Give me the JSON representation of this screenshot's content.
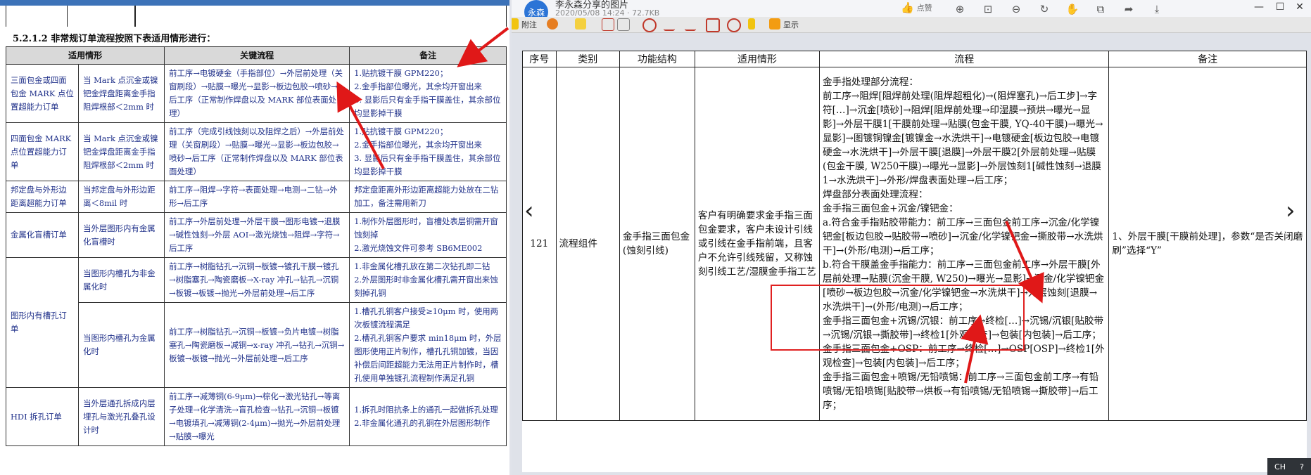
{
  "left_doc": {
    "section_title": "5.2.1.2 非常规订单流程按照下表适用情形进行：",
    "headers": [
      "适用情形",
      "关键流程",
      "备注"
    ],
    "rows": [
      {
        "case": "三面包金或四面包金 MARK 点位置超能力订单",
        "cond": "当 Mark 点沉金或镍钯金焊盘距离金手指阻焊根部＜2mm 时",
        "flow": "前工序→电镀硬金（手指部位）→外层前处理（关窗刷段）→贴膜→曝光→显影→板边包胶→喷砂→后工序（正常制作焊盘以及 MARK 部位表面处理）",
        "note": "1.贴抗镀干膜 GPM220；\n2.金手指部位曝光，其余均开窗出来\n3. 显影后只有金手指干膜盖住，其余部位均显影掉干膜"
      },
      {
        "case": "四面包金 MARK 点位置超能力订单",
        "cond": "当 Mark 点沉金或镍钯金焊盘距离金手指阻焊根部＜2mm 时",
        "flow": "前工序（完成引线蚀刻以及阻焊之后）→外层前处理（关窗刷段）→贴膜→曝光→显影→板边包胶→喷砂→后工序（正常制作焊盘以及 MARK 部位表面处理）",
        "note": "1.贴抗镀干膜 GPM220；\n2.金手指部位曝光，其余均开窗出来\n3. 显影后只有金手指干膜盖住，其余部位均显影掉干膜"
      },
      {
        "case": "邦定盘与外形边距离超能力订单",
        "cond": "当邦定盘与外形边距离＜8mil 时",
        "flow": "前工序→阻焊→字符→表面处理→电测→二钻→外形→后工序",
        "note": "邦定盘距离外形边距离超能力处放在二钻加工，备注需用新刀"
      },
      {
        "case": "金属化盲槽订单",
        "cond": "当外层图形内有金属化盲槽时",
        "flow": "前工序→外层前处理→外层干膜→图形电镀→退膜→碱性蚀刻→外层 AOI→激光烧蚀→阻焊→字符→后工序",
        "note": "1.制作外层图形时，盲槽处表层铜需开窗蚀刻掉\n2.激光烧蚀文件可参考 SB6ME002"
      },
      {
        "case": "图形内有槽孔订单",
        "cond": "当图形内槽孔为非金属化时",
        "flow": "前工序→树脂钻孔→沉铜→板镀→镀孔干膜→镀孔→树脂塞孔→陶瓷磨板→X-ray 冲孔→钻孔→沉铜→板镀→板镀→抛光→外层前处理→后工序",
        "note": "1.非金属化槽孔放在第二次钻孔即二钻\n2.外层图形时非金属化槽孔需开窗出来蚀刻掉孔铜"
      },
      {
        "case": "",
        "cond": "当图形内槽孔为金属化时",
        "flow": "前工序→树脂钻孔→沉铜→板镀→负片电镀→树脂塞孔→陶瓷磨板→减铜→x-ray 冲孔→钻孔→沉铜→板镀→板镀→抛光→外层前处理→后工序",
        "note": "1.槽孔孔铜客户接受≥10μm 时，使用两次板镀流程满足\n2.槽孔孔铜客户要求 min18μm 时，外层图形使用正片制作，槽孔孔铜加镀，当因补偿后间距超能力无法用正片制作时，槽孔使用单独镀孔流程制作满足孔铜"
      },
      {
        "case": "HDI 拆孔订单",
        "cond": "当外层通孔拆成内层埋孔与激光孔叠孔设计时",
        "flow": "前工序→减薄铜(6-9μm)→棕化→激光钻孔→等离子处理→化学清洗→盲孔检查→钻孔→沉铜→板镀→电镀填孔→减薄铜(2-4μm)→抛光→外层前处理→贴膜→曝光",
        "note": "1.拆孔时阻抗条上的通孔一起做拆孔处理\n2.非金属化通孔的孔铜在外层图形制作"
      }
    ]
  },
  "viewer": {
    "avatar": "永森",
    "title": "李永森分享的图片",
    "meta": "2020/05/08 14:24 · 72.7KB",
    "like_label": "点赞",
    "pdf_tool_labels": [
      "附注",
      "显示"
    ]
  },
  "right_doc": {
    "headers": [
      "序号",
      "类别",
      "功能结构",
      "适用情形",
      "流程",
      "备注"
    ],
    "row": {
      "seq": "121",
      "category": "流程组件",
      "function": "金手指三面包金(蚀刻引线)",
      "case": "客户有明确要求金手指三面包金要求，客户未设计引线或引线在金手指前端，且客户不允许引线残留，又称蚀刻引线工艺/湿膜金手指工艺",
      "process": [
        "金手指处理部分流程：",
        "前工序→阻焊[阻焊前处理(阻焊超粗化)→(阻焊塞孔)→后工步]→字符[…]→沉金[喷砂]→阻焊[阻焊前处理→印湿膜→预烘→曝光→显影]→外层干膜1[干膜前处理→贴膜(包金干膜, YQ-40干膜)→曝光→显影]→图镀铜镍金[镀镍金→水洗烘干]→电镀硬金[板边包胶→电镀硬金→水洗烘干]→外层干膜[退膜]→外层干膜2[外层前处理→贴膜(包金干膜, W250干膜)→曝光→显影]→外层蚀刻1[碱性蚀刻→退膜1→水洗烘干]→外形/焊盘表面处理→后工序；",
        "焊盘部分表面处理流程：",
        "金手指三面包金+沉金/镍钯金：",
        "a.符合金手指贴胶带能力：前工序→三面包金前工序→沉金/化学镍钯金[板边包胶→贴胶带→喷砂]→沉金/化学镍钯金→撕胶带→水洗烘干]→(外形/电测)→后工序；",
        "b.符合干膜盖金手指能力：前工序→三面包金前工序→外层干膜[外层前处理→贴膜(沉金干膜, W250)→曝光→显影]→沉金/化学镍钯金[喷砂→板边包胶→沉金/化学镍钯金→水洗烘干]→外层蚀刻[退膜→水洗烘干]→(外形/电测)→后工序；",
        "金手指三面包金+沉锡/沉银：前工序→终检[…]→沉锡/沉银[贴胶带→沉锡/沉银→撕胶带]→终检1[外观检查]→包装[内包装]→后工序；",
        "金手指三面包金+OSP：前工序→终检[…]→OSP[OSP]→终检1[外观检查]→包装[内包装]→后工序；",
        "金手指三面包金+喷锡/无铅喷锡：前工序→三面包金前工序→有铅喷锡/无铅喷锡[贴胶带→烘板→有铅喷锡/无铅喷锡→撕胶带]→后工序；"
      ],
      "remark": "1、外层干膜[干膜前处理]，参数“是否关闭磨刷”选择“Y”"
    }
  },
  "taskbar": {
    "lang": "CH",
    "help": "?"
  }
}
